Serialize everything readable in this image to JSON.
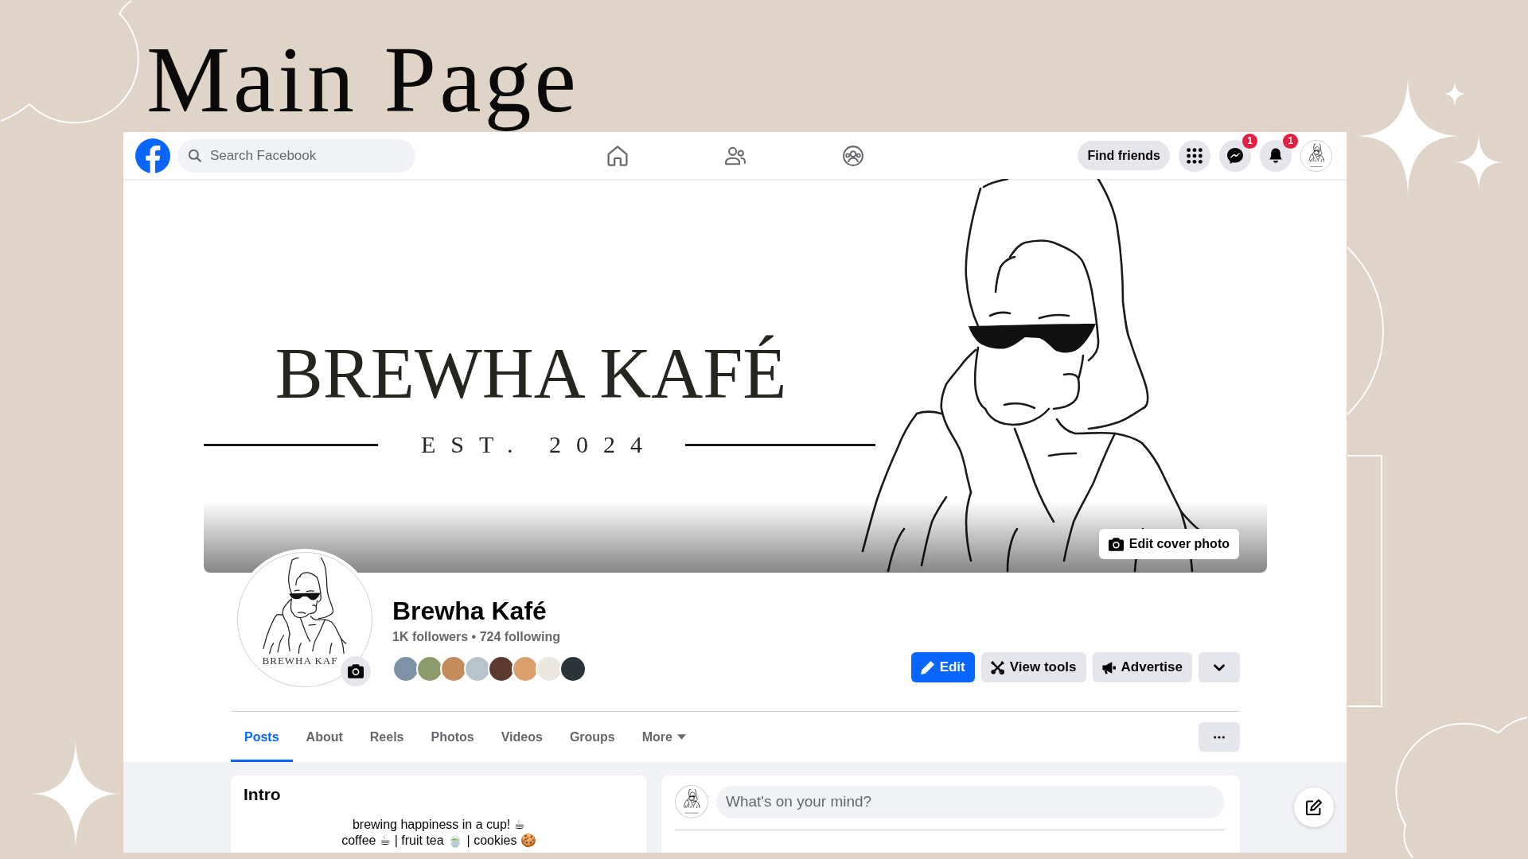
{
  "slide_title": "Main Page",
  "navbar": {
    "search": {
      "placeholder": "Search Facebook"
    },
    "nav_items": [
      {
        "kind": "home",
        "selected": false
      },
      {
        "kind": "friends",
        "selected": false
      },
      {
        "kind": "groups",
        "selected": false
      }
    ],
    "find_friends": "Find friends",
    "actions": [
      {
        "kind": "menu"
      },
      {
        "kind": "chat",
        "badge": "1"
      },
      {
        "kind": "notifications",
        "badge": "1"
      }
    ],
    "account": [
      {
        "kind": "avatar"
      }
    ]
  },
  "cover_photo": {
    "logo_text": "BREWHA KAFÉ",
    "tagline": "EST. 2024",
    "edit_button": "Edit cover photo"
  },
  "profile": {
    "picture_text": "BREWHA KAF",
    "name": "Brewha Kafé",
    "stats": "1K followers • 724 following",
    "friend_avatars": [
      {
        "kind": "photo"
      },
      {
        "kind": "photo"
      },
      {
        "kind": "photo"
      },
      {
        "kind": "photo"
      },
      {
        "kind": "photo"
      },
      {
        "kind": "photo"
      },
      {
        "kind": "photo"
      },
      {
        "kind": "photo"
      }
    ],
    "buttons": [
      {
        "kind": "edit",
        "label": "Edit"
      },
      {
        "kind": "tools",
        "label": "View tools"
      },
      {
        "kind": "advertise",
        "label": "Advertise"
      },
      {
        "kind": "dropdown"
      }
    ]
  },
  "tabs": [
    {
      "label": "Posts",
      "selected": true,
      "dropdown": false
    },
    {
      "label": "About",
      "selected": false,
      "dropdown": false
    },
    {
      "label": "Reels",
      "selected": false,
      "dropdown": false
    },
    {
      "label": "Photos",
      "selected": false,
      "dropdown": false
    },
    {
      "label": "Videos",
      "selected": false,
      "dropdown": false
    },
    {
      "label": "Groups",
      "selected": false,
      "dropdown": false
    },
    {
      "label": "More",
      "selected": false,
      "dropdown": true
    }
  ],
  "tab_actions": [
    {
      "kind": "more"
    }
  ],
  "intro": {
    "title": "Intro",
    "bio": [
      "brewing happiness in a cup! ☕",
      "coffee ☕ | fruit tea 🍵 | cookies 🍪"
    ]
  },
  "composer": {
    "placeholder": "What's on your mind?"
  },
  "floating_buttons": [
    {
      "kind": "compose"
    }
  ]
}
